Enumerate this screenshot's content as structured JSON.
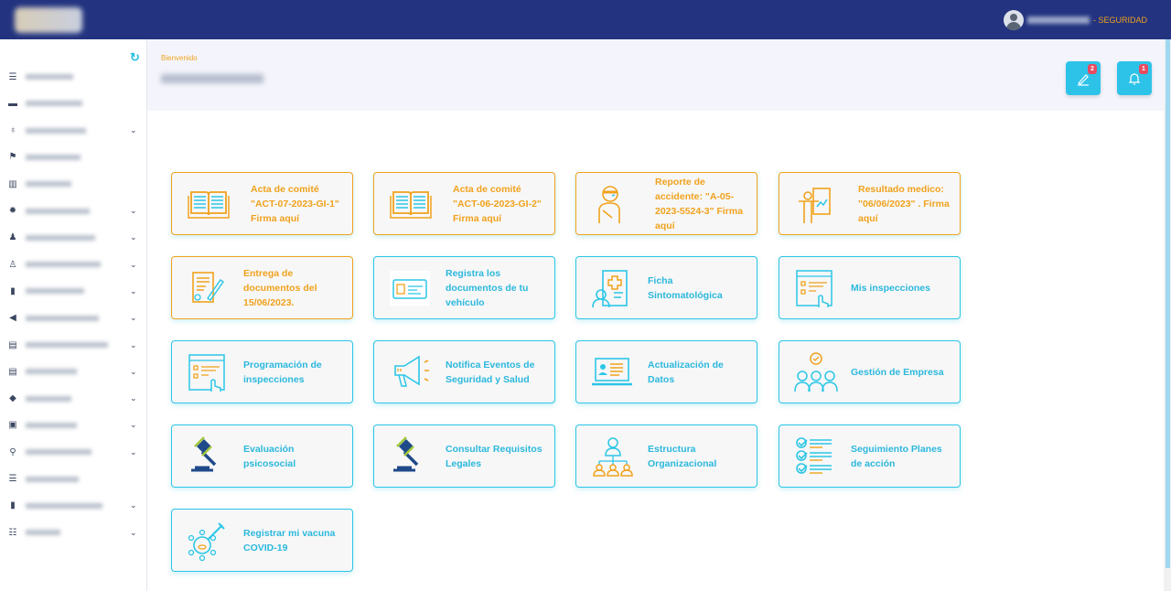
{
  "header": {
    "role_suffix": "- SEGURIDAD"
  },
  "sidebar": {
    "items": [
      {
        "icon": "list-check-icon",
        "expandable": false
      },
      {
        "icon": "car-icon",
        "expandable": false
      },
      {
        "icon": "award-icon",
        "expandable": true
      },
      {
        "icon": "flag-icon",
        "expandable": false
      },
      {
        "icon": "bar-chart-icon",
        "expandable": false
      },
      {
        "icon": "virus-icon",
        "expandable": true
      },
      {
        "icon": "user-doctor-icon",
        "expandable": true
      },
      {
        "icon": "user-injured-icon",
        "expandable": true
      },
      {
        "icon": "bookmark-icon",
        "expandable": true
      },
      {
        "icon": "megaphone-icon",
        "expandable": true
      },
      {
        "icon": "committee-icon",
        "expandable": true
      },
      {
        "icon": "document-list-icon",
        "expandable": true
      },
      {
        "icon": "ppe-icon",
        "expandable": true
      },
      {
        "icon": "calendar-check-icon",
        "expandable": true
      },
      {
        "icon": "microscope-icon",
        "expandable": true
      },
      {
        "icon": "list-check-icon",
        "expandable": false
      },
      {
        "icon": "file-icon",
        "expandable": true
      },
      {
        "icon": "table-icon",
        "expandable": true
      }
    ]
  },
  "banner": {
    "welcome": "Bienvenido"
  },
  "actions": {
    "signatures_badge": "2",
    "notifications_badge": "1"
  },
  "colors": {
    "header": "#23337f",
    "orange": "#f0a21c",
    "cyan": "#2bc6e6",
    "badge": "#e84a5f"
  },
  "cards": [
    {
      "label": "Acta de comité \"ACT-07-2023-GI-1\" Firma aquí",
      "style": "orange",
      "icon": "book-icon"
    },
    {
      "label": "Acta de comité \"ACT-06-2023-GI-2\" Firma aquí",
      "style": "orange",
      "icon": "book-icon"
    },
    {
      "label": "Reporte de accidente: \"A-05-2023-5524-3\" Firma aquí",
      "style": "orange",
      "icon": "injured-person-icon"
    },
    {
      "label": "Resultado medico: \"06/06/2023\" . Firma aquí",
      "style": "orange",
      "icon": "medical-board-icon"
    },
    {
      "label": "Entrega de documentos del 15/06/2023.",
      "style": "orange",
      "icon": "signed-document-icon"
    },
    {
      "label": "Registra los documentos de tu vehículo",
      "style": "cyan",
      "icon": "id-card-icon"
    },
    {
      "label": "Ficha Sintomatológica",
      "style": "cyan",
      "icon": "medical-record-icon"
    },
    {
      "label": "Mis inspecciones",
      "style": "cyan",
      "icon": "checklist-click-icon"
    },
    {
      "label": "Programación de inspecciones",
      "style": "cyan",
      "icon": "checklist-click-icon"
    },
    {
      "label": "Notifica Eventos de Seguridad y Salud",
      "style": "cyan",
      "icon": "megaphone-icon"
    },
    {
      "label": "Actualización de Datos",
      "style": "cyan",
      "icon": "laptop-profile-icon"
    },
    {
      "label": "Gestión de Empresa",
      "style": "cyan",
      "icon": "team-icon"
    },
    {
      "label": "Evaluación psicosocial",
      "style": "cyan",
      "icon": "gavel-icon"
    },
    {
      "label": "Consultar Requisitos Legales",
      "style": "cyan",
      "icon": "gavel-icon"
    },
    {
      "label": "Estructura Organizacional",
      "style": "cyan",
      "icon": "org-chart-icon"
    },
    {
      "label": "Seguimiento Planes de acción",
      "style": "cyan",
      "icon": "checklist-icon"
    },
    {
      "label": "Registrar mi vacuna COVID-19",
      "style": "cyan",
      "icon": "vaccine-icon"
    }
  ]
}
